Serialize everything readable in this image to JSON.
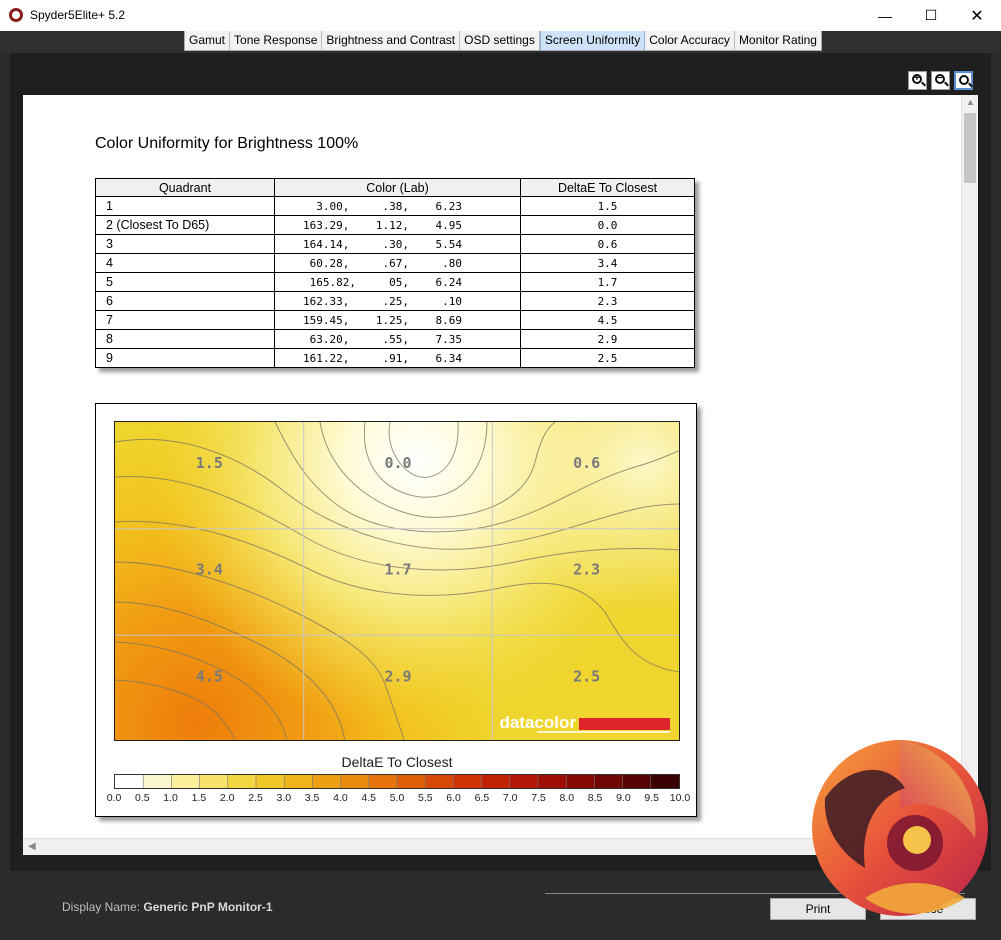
{
  "window": {
    "title": "Spyder5Elite+ 5.2"
  },
  "tabs": [
    {
      "label": "Gamut",
      "active": false
    },
    {
      "label": "Tone Response",
      "active": false
    },
    {
      "label": "Brightness and Contrast",
      "active": false
    },
    {
      "label": "OSD settings",
      "active": false
    },
    {
      "label": "Screen Uniformity",
      "active": true
    },
    {
      "label": "Color Accuracy",
      "active": false
    },
    {
      "label": "Monitor Rating",
      "active": false
    }
  ],
  "zoom_tools": [
    "zoom-in-icon",
    "zoom-out-icon",
    "zoom-fit-icon"
  ],
  "report": {
    "title": "Color Uniformity for Brightness 100%",
    "table": {
      "headers": [
        "Quadrant",
        "Color (Lab)",
        "DeltaE To Closest"
      ],
      "rows": [
        {
          "quadrant": "1",
          "lab": "3.00,     .38,    6.23",
          "delta": "1.5"
        },
        {
          "quadrant": "2 (Closest To D65)",
          "lab": "163.29,    1.12,    4.95",
          "delta": "0.0"
        },
        {
          "quadrant": "3",
          "lab": "164.14,     .30,    5.54",
          "delta": "0.6"
        },
        {
          "quadrant": "4",
          "lab": "60.28,     .67,     .80",
          "delta": "3.4"
        },
        {
          "quadrant": "5",
          "lab": "165.82,     05,    6.24",
          "delta": "1.7"
        },
        {
          "quadrant": "6",
          "lab": "162.33,     .25,     .10",
          "delta": "2.3"
        },
        {
          "quadrant": "7",
          "lab": "159.45,    1.25,    8.69",
          "delta": "4.5"
        },
        {
          "quadrant": "8",
          "lab": "63.20,     .55,    7.35",
          "delta": "2.9"
        },
        {
          "quadrant": "9",
          "lab": "161.22,     .91,    6.34",
          "delta": "2.5"
        }
      ]
    },
    "map": {
      "cell_values": [
        "1.5",
        "0.0",
        "0.6",
        "3.4",
        "1.7",
        "2.3",
        "4.5",
        "2.9",
        "2.5"
      ],
      "brand": "datacolor",
      "brand_color": "#e0242b",
      "legend_title": "DeltaE To Closest",
      "legend_ticks": [
        "0.0",
        "0.5",
        "1.0",
        "1.5",
        "2.0",
        "2.5",
        "3.0",
        "3.5",
        "4.0",
        "4.5",
        "5.0",
        "5.5",
        "6.0",
        "6.5",
        "7.0",
        "7.5",
        "8.0",
        "8.5",
        "9.0",
        "9.5",
        "10.0"
      ]
    }
  },
  "footer": {
    "display_name_label": "Display Name:",
    "display_name_value": "Generic PnP Monitor-1",
    "print_label": "Print",
    "close_label": "Close"
  }
}
